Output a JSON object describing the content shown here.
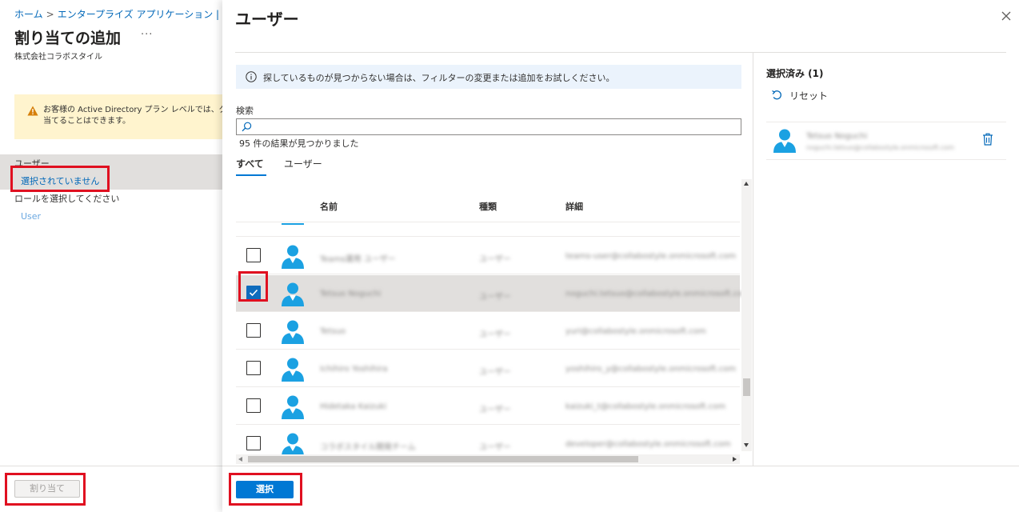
{
  "left_blade": {
    "breadcrumb": [
      "ホーム",
      "エンタープライズ アプリケーション | すべての"
    ],
    "title": "割り当ての追加",
    "more": "···",
    "subtitle": "株式会社コラボスタイル",
    "warning_lines": [
      "お客様の Active Directory プラン レベルでは、グル",
      "当てることはできます。"
    ],
    "user_section_label": "ユーザー",
    "user_section_value": "選択されていません",
    "role_label": "ロールを選択してください",
    "role_value": "User",
    "assign_button": "割り当て"
  },
  "panel": {
    "title": "ユーザー",
    "info_text": "探しているものが見つからない場合は、フィルターの変更または追加をお試しください。",
    "search_label": "検索",
    "search_placeholder": "",
    "result_count": "95 件の結果が見つかりました",
    "tabs": [
      {
        "label": "すべて",
        "active": true
      },
      {
        "label": "ユーザー",
        "active": false
      }
    ],
    "columns": {
      "name": "名前",
      "type": "種類",
      "detail": "詳細"
    },
    "rows": [
      {
        "name": "Teams運用 ユーザー",
        "type": "ユーザー",
        "detail": "teams-user@collabostyle.onmicrosoft.com",
        "checked": false
      },
      {
        "name": "Tetsuo Noguchi",
        "type": "ユーザー",
        "detail": "noguchi.tetsuo@collabostyle.onmicrosoft.com",
        "checked": true
      },
      {
        "name": "Tetsuo",
        "type": "ユーザー",
        "detail": "yuri@collabostyle.onmicrosoft.com",
        "checked": false
      },
      {
        "name": "Ichihiro Yoshihira",
        "type": "ユーザー",
        "detail": "yoshihiro_y@collabostyle.onmicrosoft.com",
        "checked": false
      },
      {
        "name": "Hidetaka Kaizuki",
        "type": "ユーザー",
        "detail": "kaizuki_t@collabostyle.onmicrosoft.com",
        "checked": false
      },
      {
        "name": "コラボスタイル開発チーム",
        "type": "ユーザー",
        "detail": "developer@collabostyle.onmicrosoft.com",
        "checked": false
      }
    ],
    "selected_title": "選択済み (1)",
    "reset_label": "リセット",
    "selected_item": {
      "name": "Tetsuo Noguchi",
      "mail": "noguchi.tetsuo@collabostyle.onmicrosoft.com"
    },
    "select_button": "選択"
  },
  "colors": {
    "accent": "#0078d4",
    "highlight": "#e01020",
    "avatar": "#1ba1e2"
  }
}
